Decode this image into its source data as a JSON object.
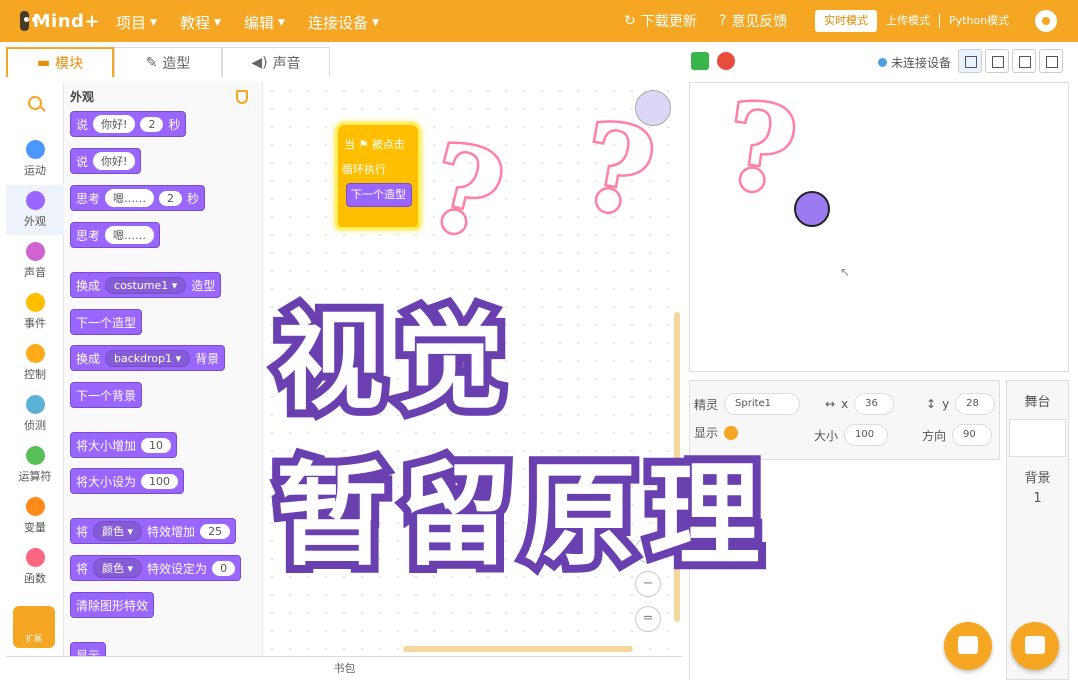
{
  "app": {
    "logo_text": "Mind+"
  },
  "menu": [
    {
      "label": "项目"
    },
    {
      "label": "教程"
    },
    {
      "label": "编辑"
    },
    {
      "label": "连接设备"
    }
  ],
  "top_right": {
    "download": "下载更新",
    "feedback": "意见反馈",
    "modes": [
      "实时模式",
      "上传模式",
      "Python模式"
    ]
  },
  "tabs": [
    "模块",
    "造型",
    "声音"
  ],
  "stage_toolbar": {
    "connection": "未连接设备"
  },
  "categories": [
    {
      "label": "运动",
      "color": "#4c97ff"
    },
    {
      "label": "外观",
      "color": "#9966ff"
    },
    {
      "label": "声音",
      "color": "#cf63cf"
    },
    {
      "label": "事件",
      "color": "#ffbf00"
    },
    {
      "label": "控制",
      "color": "#ffab19"
    },
    {
      "label": "侦测",
      "color": "#5cb1d6"
    },
    {
      "label": "运算符",
      "color": "#59c059"
    },
    {
      "label": "变量",
      "color": "#ff8c1a"
    },
    {
      "label": "函数",
      "color": "#ff6680"
    }
  ],
  "extensions": {
    "label": "扩展"
  },
  "palette": {
    "title": "外观",
    "blocks": [
      {
        "parts": [
          "说",
          "你好!",
          "2",
          "秒"
        ]
      },
      {
        "parts": [
          "说",
          "你好!"
        ]
      },
      {
        "parts": [
          "思考",
          "嗯……",
          "2",
          "秒"
        ]
      },
      {
        "parts": [
          "思考",
          "嗯……"
        ]
      },
      {
        "parts": [
          "换成",
          "costume1 ▾",
          "造型"
        ]
      },
      {
        "parts": [
          "下一个造型"
        ]
      },
      {
        "parts": [
          "换成",
          "backdrop1 ▾",
          "背景"
        ]
      },
      {
        "parts": [
          "下一个背景"
        ]
      },
      {
        "parts": [
          "将大小增加",
          "10"
        ]
      },
      {
        "parts": [
          "将大小设为",
          "100"
        ]
      },
      {
        "parts": [
          "将",
          "颜色 ▾",
          "特效增加",
          "25"
        ]
      },
      {
        "parts": [
          "将",
          "颜色 ▾",
          "特效设定为",
          "0"
        ]
      },
      {
        "parts": [
          "清除图形特效"
        ]
      },
      {
        "parts": [
          "显示"
        ]
      }
    ]
  },
  "script": {
    "hat": "当 ⚑ 被点击",
    "loop": "循环执行",
    "inner": "下一个造型"
  },
  "zoom": {
    "in": "+",
    "out": "−",
    "reset": "="
  },
  "backpack": "书包",
  "overlay": {
    "line1": "视觉",
    "line2": "暂留原理"
  },
  "decor": {
    "question": "?"
  },
  "sprite_info": {
    "sprite_label": "精灵",
    "sprite_name": "Sprite1",
    "x_label": "x",
    "x_value": "36",
    "y_label": "y",
    "y_value": "28",
    "show_label": "显示",
    "size_label": "大小",
    "size_value": "100",
    "direction_label": "方向",
    "direction_value": "90"
  },
  "stage_panel": {
    "title": "舞台",
    "backdrop_label": "背景",
    "backdrop_count": "1"
  }
}
